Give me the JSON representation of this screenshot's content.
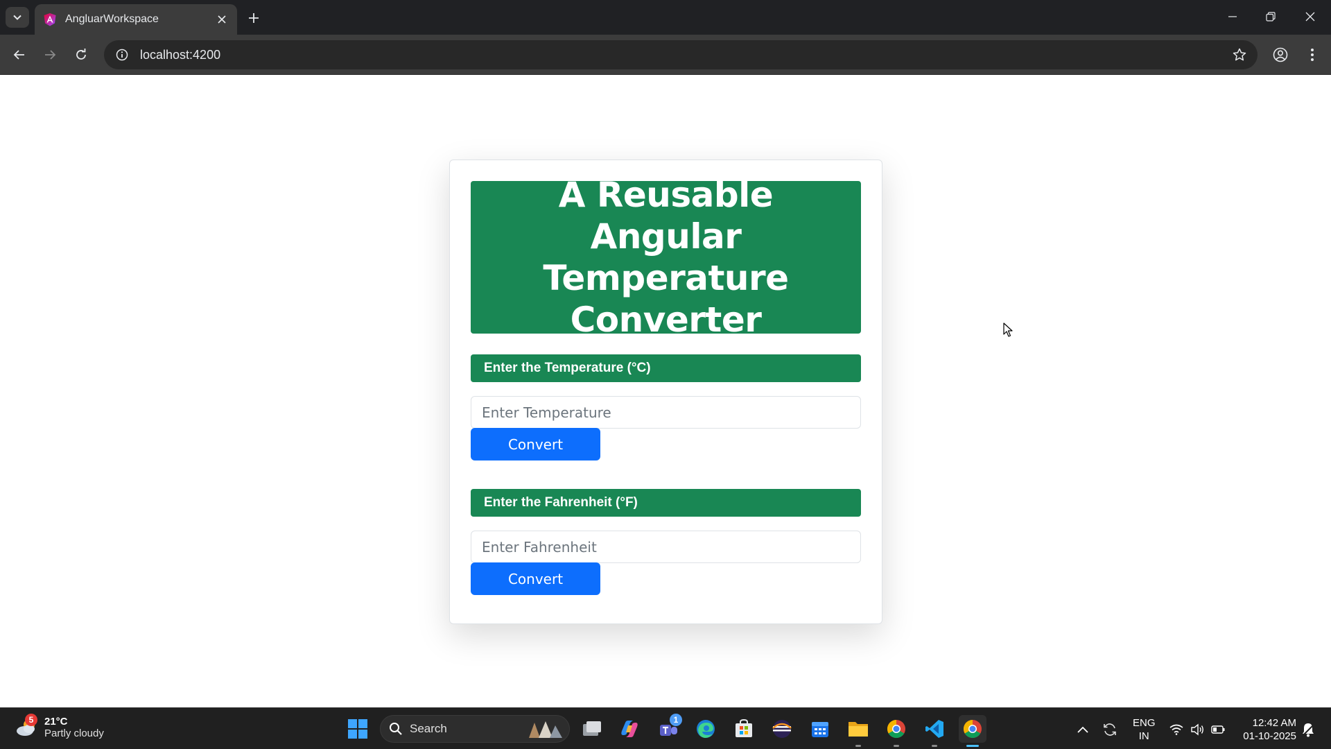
{
  "browser": {
    "tab_title": "AngluarWorkspace",
    "url": "localhost:4200"
  },
  "page": {
    "header_title": "A Reusable Angular Temperature Converter",
    "celsius": {
      "label": "Enter the Temperature (°C)",
      "placeholder": "Enter Temperature",
      "value": "",
      "button_label": "Convert"
    },
    "fahrenheit": {
      "label": "Enter the Fahrenheit (°F)",
      "placeholder": "Enter Fahrenheit",
      "value": "",
      "button_label": "Convert"
    }
  },
  "taskbar": {
    "weather": {
      "badge": "5",
      "temp": "21°C",
      "description": "Partly cloudy"
    },
    "search_label": "Search",
    "teams_badge": "1",
    "language": {
      "line1": "ENG",
      "line2": "IN"
    },
    "clock": {
      "time": "12:42 AM",
      "date": "01-10-2025"
    }
  },
  "colors": {
    "header_green": "#198754",
    "button_blue": "#0d6efd",
    "chrome_dark": "#202124",
    "toolbar": "#3c3c3c"
  },
  "icons": [
    "tab-search-icon",
    "angular-favicon-icon",
    "close-icon",
    "plus-icon",
    "minimize-icon",
    "restore-icon",
    "back-icon",
    "forward-icon",
    "reload-icon",
    "info-icon",
    "star-icon",
    "profile-icon",
    "menu-icon",
    "windows-start-icon",
    "search-icon",
    "task-view-icon",
    "copilot-icon",
    "teams-icon",
    "edge-icon",
    "store-icon",
    "eclipse-icon",
    "calendar-icon",
    "file-explorer-icon",
    "chrome-icon",
    "vscode-icon",
    "chevron-up-icon",
    "sync-icon",
    "wifi-icon",
    "volume-icon",
    "battery-icon",
    "notification-icon"
  ]
}
